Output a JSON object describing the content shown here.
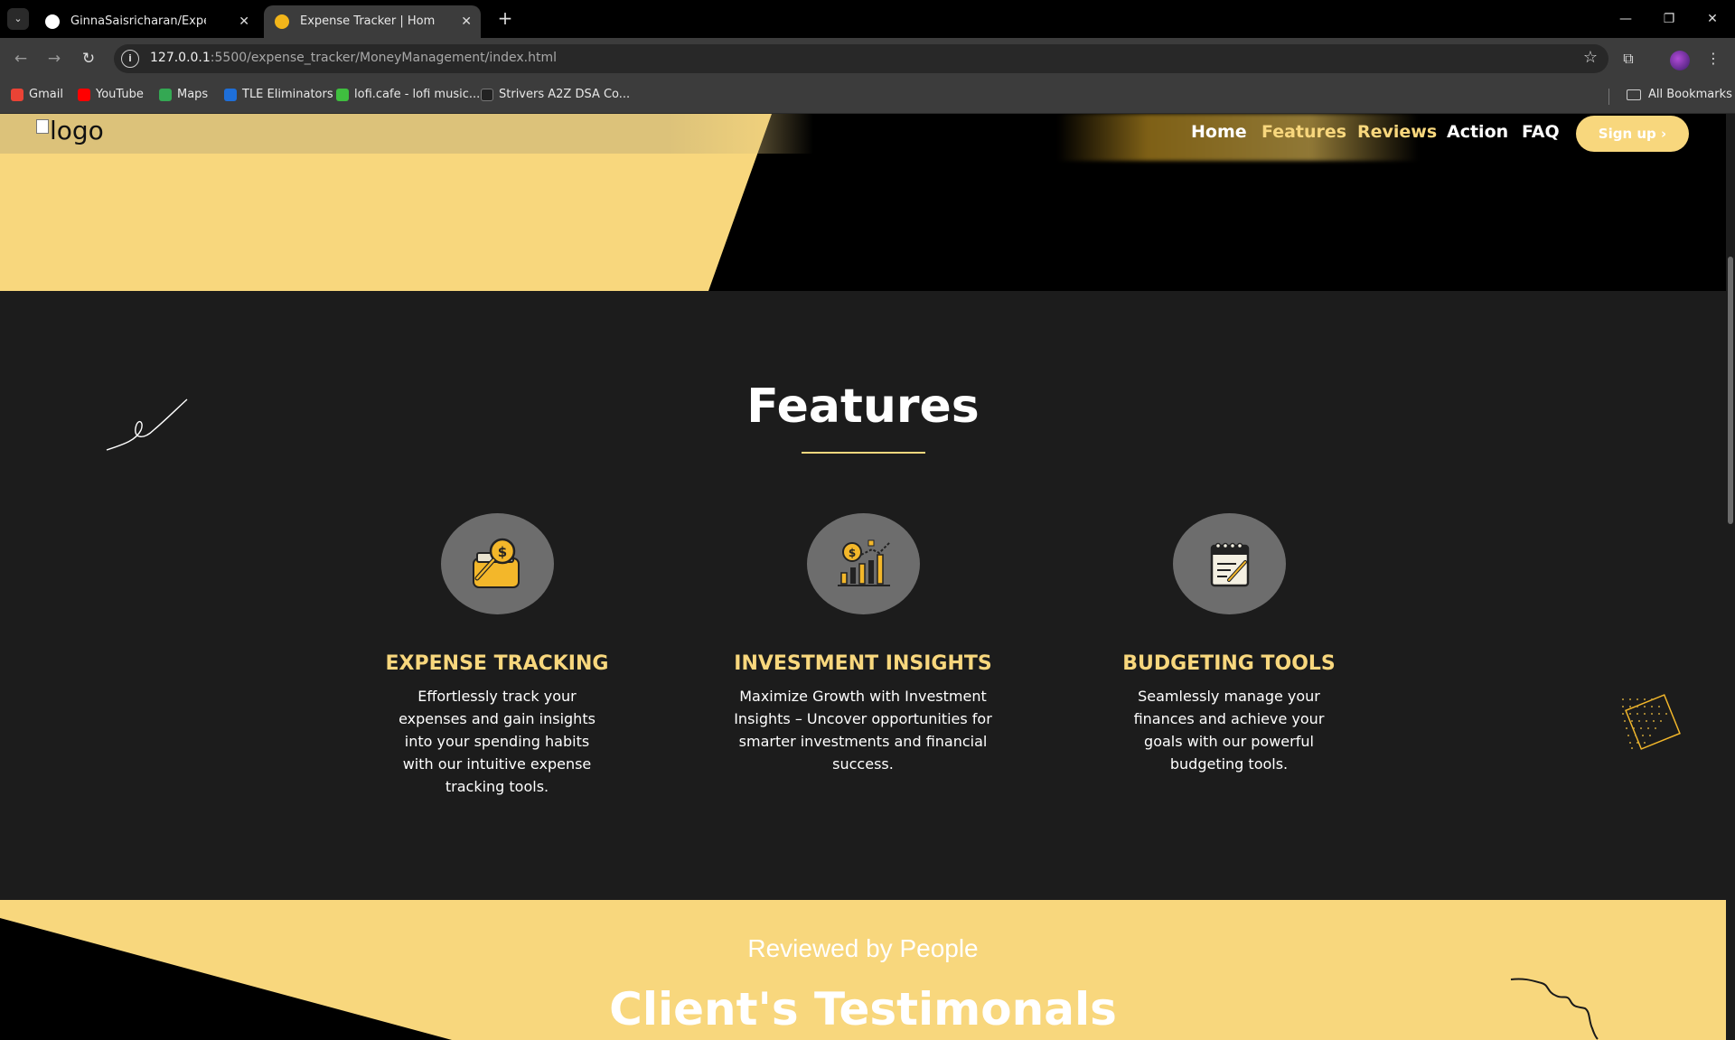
{
  "browser": {
    "tabs": [
      {
        "title": "GinnaSaisricharan/Expense-Trac",
        "active": false
      },
      {
        "title": "Expense Tracker | Home",
        "active": true
      }
    ],
    "url_host": "127.0.0.1",
    "url_path": ":5500/expense_tracker/MoneyManagement/index.html",
    "bookmarks": [
      "Gmail",
      "YouTube",
      "Maps",
      "TLE Eliminators",
      "lofi.cafe - lofi music...",
      "Strivers A2Z DSA Co..."
    ],
    "all_bookmarks": "All Bookmarks"
  },
  "page": {
    "logo_alt": "logo",
    "nav": {
      "links": [
        "Home",
        "Features",
        "Reviews",
        "Action",
        "FAQ"
      ],
      "signup": "Sign up"
    },
    "features": {
      "title": "Features",
      "cards": [
        {
          "title": "EXPENSE TRACKING",
          "desc": "Effortlessly track your expenses and gain insights into your spending habits with our intuitive expense tracking tools.",
          "icon": "wallet-magnifier-icon"
        },
        {
          "title": "INVESTMENT INSIGHTS",
          "desc": "Maximize Growth with Investment Insights – Uncover opportunities for smarter investments and financial success.",
          "icon": "growth-chart-icon"
        },
        {
          "title": "BUDGETING TOOLS",
          "desc": "Seamlessly manage your finances and achieve your goals with our powerful budgeting tools.",
          "icon": "budget-notepad-icon"
        }
      ]
    },
    "reviews": {
      "subtitle": "Reviewed by People",
      "title": "Client's Testimonals"
    }
  },
  "colors": {
    "accent": "#f8d77d",
    "section_bg": "#1c1c1c",
    "icon_circle": "#6d6d6d"
  }
}
